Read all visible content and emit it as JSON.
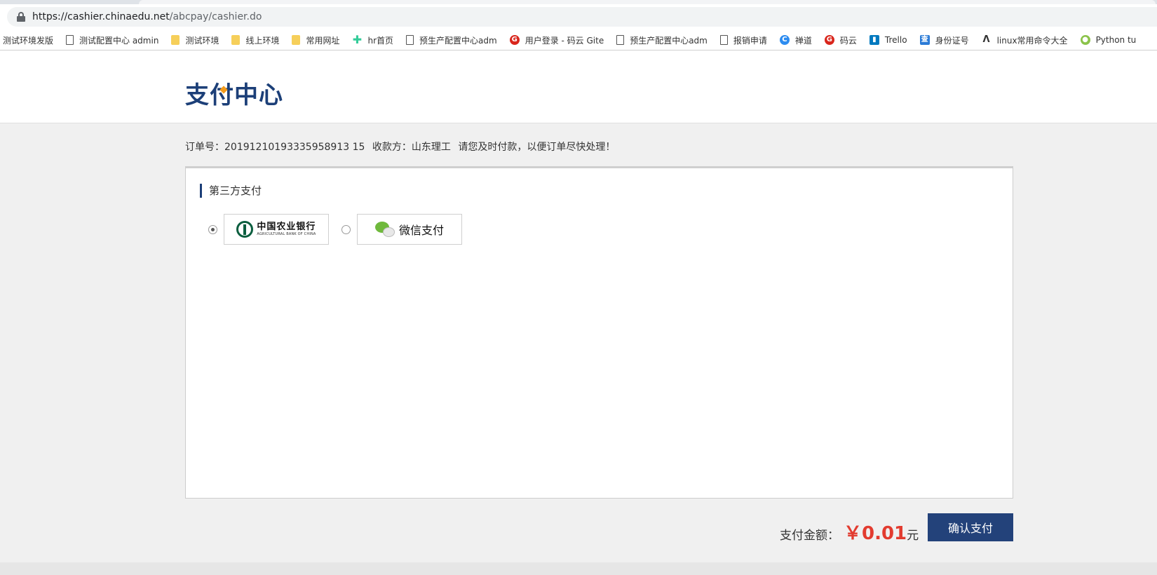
{
  "browser": {
    "url_host": "https://cashier.chinaedu.net",
    "url_path": "/abcpay/cashier.do",
    "bookmarks": [
      {
        "label": "测试环境发版",
        "icon": "none"
      },
      {
        "label": "测试配置中心 admin",
        "icon": "page-icon"
      },
      {
        "label": "测试环境",
        "icon": "folder-icon"
      },
      {
        "label": "线上环境",
        "icon": "folder-icon"
      },
      {
        "label": "常用网址",
        "icon": "folder-icon"
      },
      {
        "label": "hr首页",
        "icon": "plus-icon"
      },
      {
        "label": "预生产配置中心adm",
        "icon": "page-icon"
      },
      {
        "label": "用户登录 - 码云 Gite",
        "icon": "gitee-icon"
      },
      {
        "label": "预生产配置中心adm",
        "icon": "page-icon"
      },
      {
        "label": "报销申请",
        "icon": "page-icon"
      },
      {
        "label": "禅道",
        "icon": "chandao-icon"
      },
      {
        "label": "码云",
        "icon": "gitee-icon"
      },
      {
        "label": "Trello",
        "icon": "trello-icon"
      },
      {
        "label": "身份证号",
        "icon": "id-icon"
      },
      {
        "label": "linux常用命令大全",
        "icon": "linux-icon"
      },
      {
        "label": "Python tu",
        "icon": "python-icon"
      }
    ]
  },
  "header": {
    "logo_text": "支付中心"
  },
  "order": {
    "number_label": "订单号：",
    "number": "20191210193335958913 15",
    "payee_label": "收款方：",
    "payee": "山东理工",
    "notice": "请您及时付款，以便订单尽快处理！"
  },
  "panel": {
    "section_title": "第三方支付",
    "options": [
      {
        "name": "中国农业银行",
        "subtitle": "AGRICULTURAL BANK OF CHINA",
        "selected": true
      },
      {
        "name": "微信支付",
        "selected": false
      }
    ]
  },
  "payment": {
    "amount_label": "支付金额：",
    "amount": "￥0.01",
    "unit": "元",
    "confirm_label": "确认支付"
  },
  "colors": {
    "brand": "#1c3f78",
    "button": "#23427a",
    "amount": "#e23b2f",
    "background": "#f0f0f0"
  }
}
